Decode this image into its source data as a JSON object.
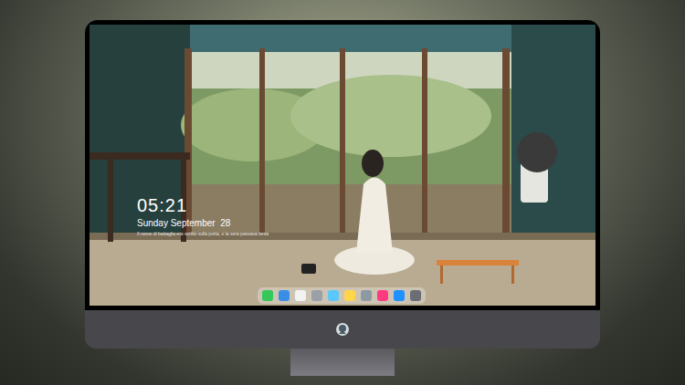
{
  "screen": {
    "clock": {
      "time": "05:21",
      "date": "Sunday September  28",
      "note": "Il nome di battaglia era scritto sulla porta, e la sera passava lenta"
    }
  },
  "dock": {
    "apps": [
      {
        "color": "#34c759"
      },
      {
        "color": "#3a8ee6"
      },
      {
        "color": "#f2f2f2"
      },
      {
        "color": "#9aa0a6"
      },
      {
        "color": "#5ac8fa"
      },
      {
        "color": "#ffd54a"
      },
      {
        "color": "#8e9aa3"
      },
      {
        "color": "#ff3b7f"
      },
      {
        "color": "#1e90ff"
      },
      {
        "color": "#6b6f75"
      }
    ]
  }
}
